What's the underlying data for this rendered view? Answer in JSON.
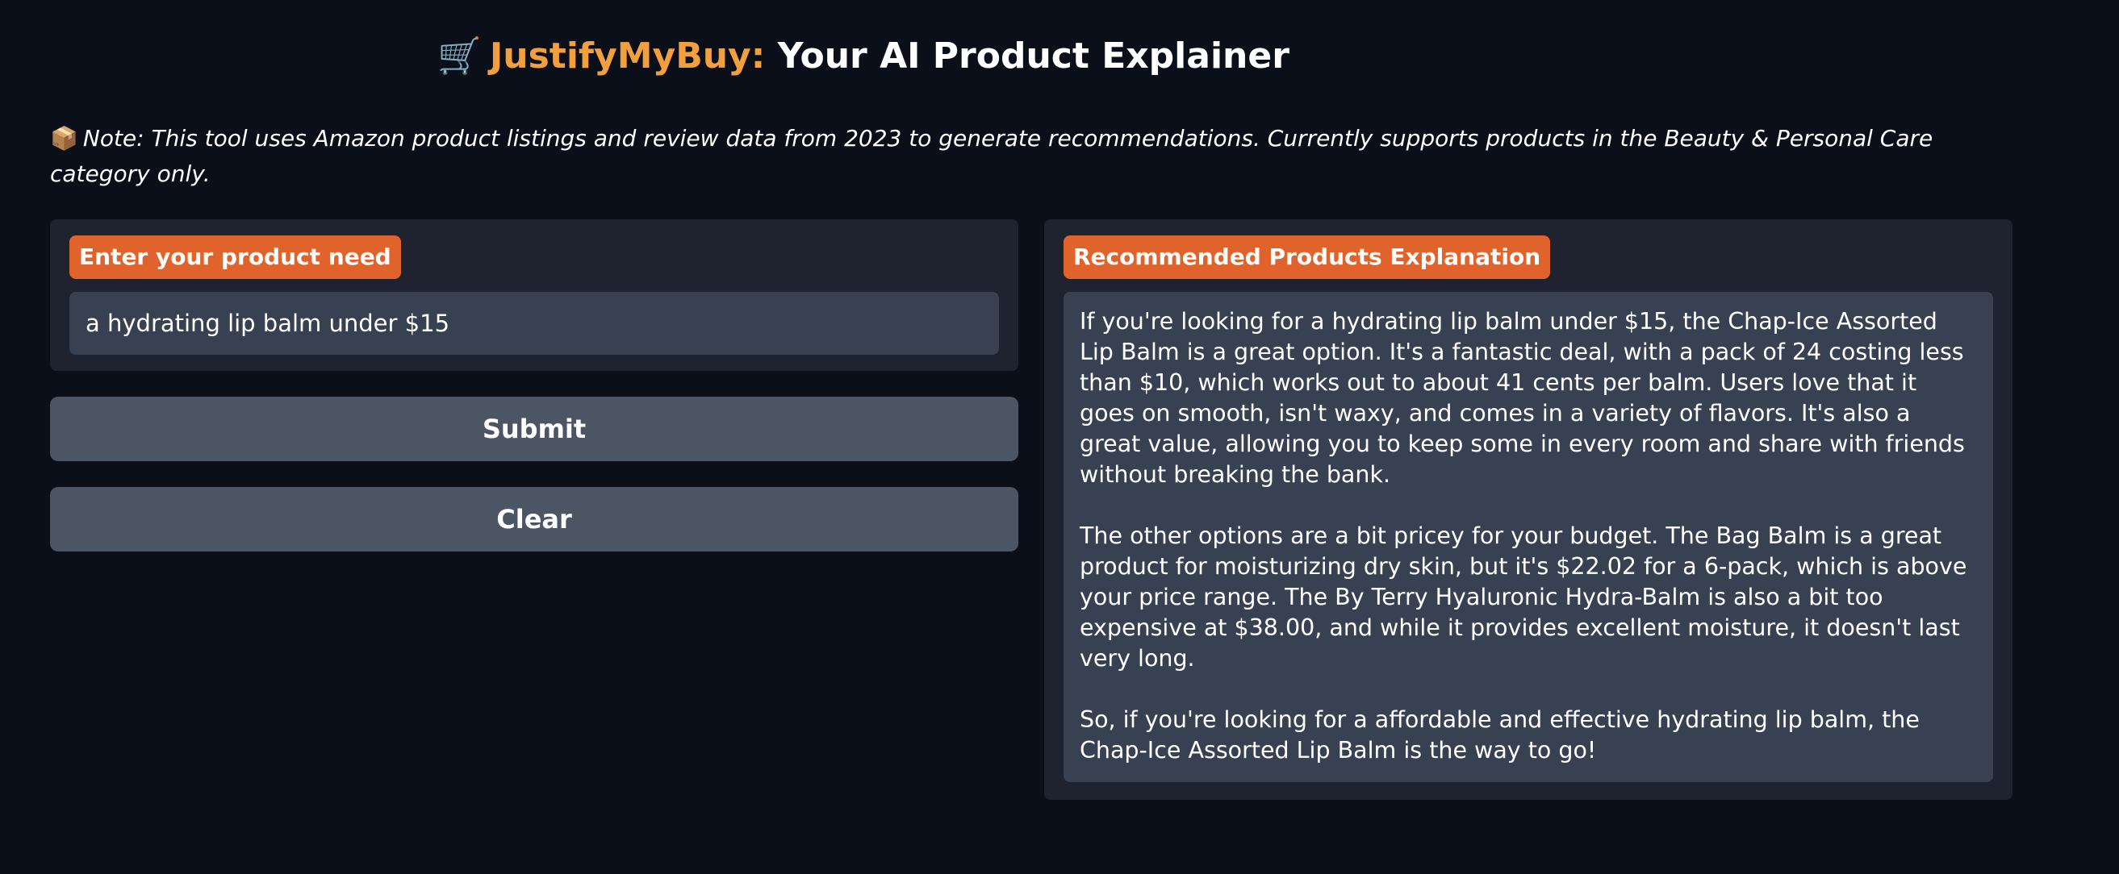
{
  "header": {
    "cart_icon": "🛒",
    "brand": "JustifyMyBuy:",
    "subtitle": "Your AI Product Explainer"
  },
  "note": {
    "icon": "📦",
    "text": "Note: This tool uses Amazon product listings and review data from 2023 to generate recommendations. Currently supports products in the Beauty & Personal Care category only."
  },
  "input_panel": {
    "label": "Enter your product need",
    "value": "a hydrating lip balm under $15"
  },
  "buttons": {
    "submit_label": "Submit",
    "clear_label": "Clear"
  },
  "output_panel": {
    "label": "Recommended Products Explanation",
    "paragraphs": [
      "If you're looking for a hydrating lip balm under $15, the Chap-Ice Assorted Lip Balm is a great option. It's a fantastic deal, with a pack of 24 costing less than $10, which works out to about 41 cents per balm. Users love that it goes on smooth, isn't waxy, and comes in a variety of flavors. It's also a great value, allowing you to keep some in every room and share with friends without breaking the bank.",
      "The other options are a bit pricey for your budget. The Bag Balm is a great product for moisturizing dry skin, but it's $22.02 for a 6-pack, which is above your price range. The By Terry Hyaluronic Hydra-Balm is also a bit too expensive at $38.00, and while it provides excellent moisture, it doesn't last very long.",
      "So, if you're looking for a affordable and effective hydrating lip balm, the Chap-Ice Assorted Lip Balm is the way to go!"
    ]
  },
  "colors": {
    "background": "#0b0f19",
    "panel": "#1f2330",
    "field": "#374151",
    "button": "#4b5563",
    "accent_badge": "#e0632b",
    "brand_text": "#f2a03d"
  }
}
